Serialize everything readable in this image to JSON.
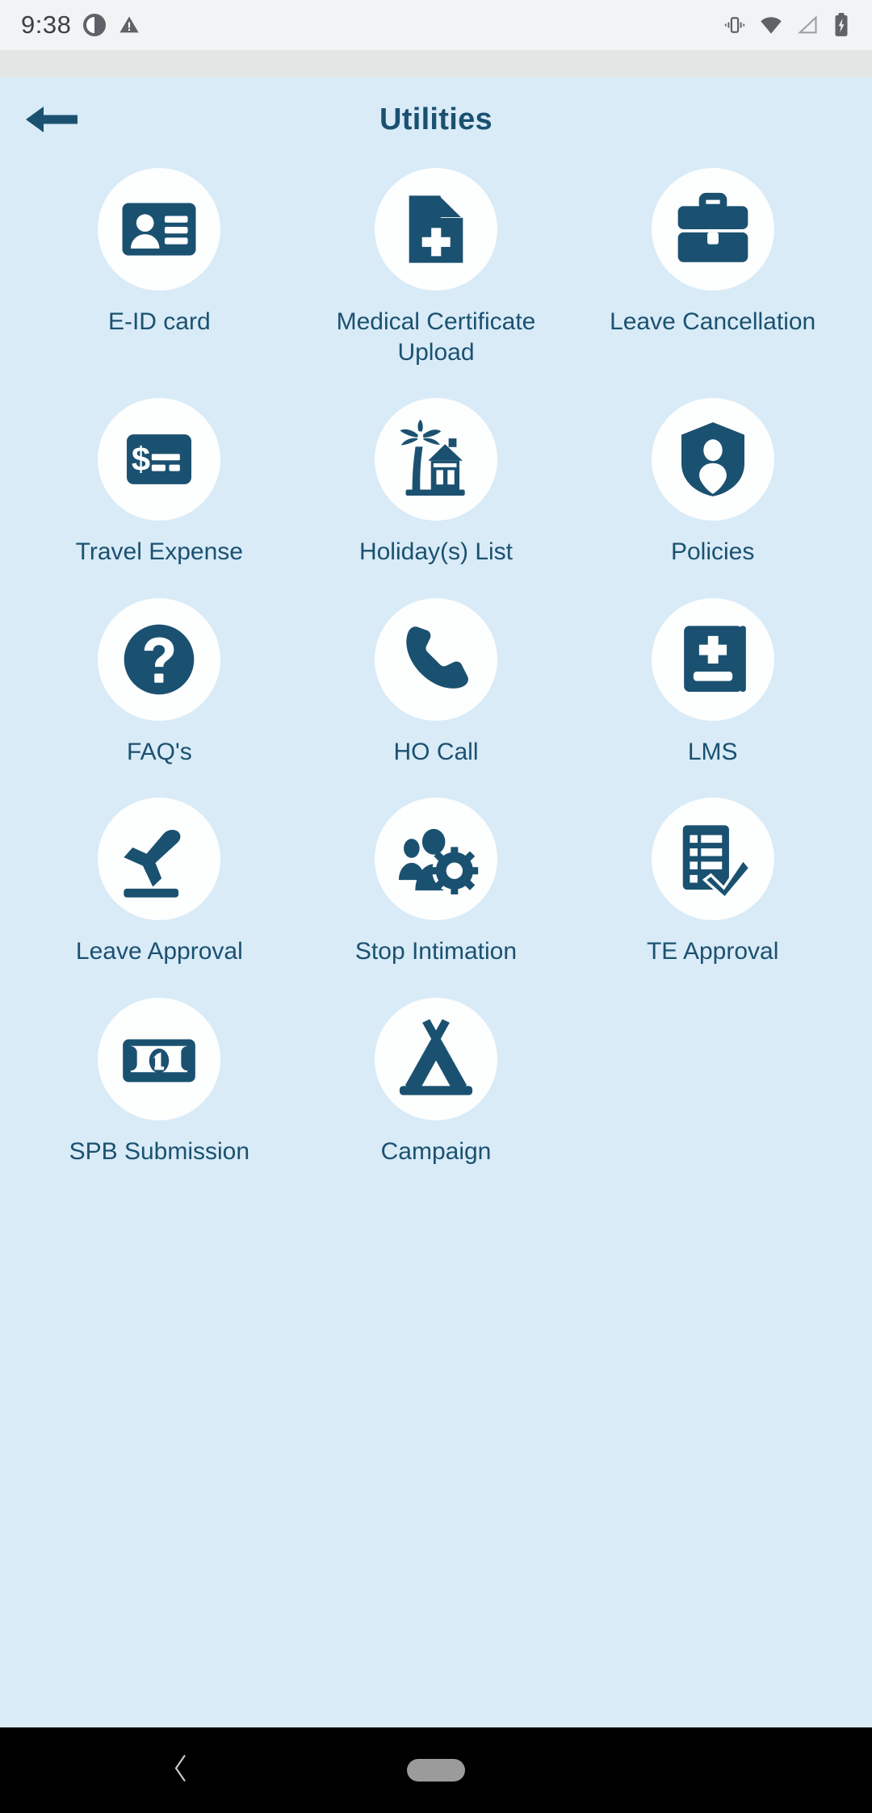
{
  "status_bar": {
    "time": "9:38",
    "left_icons": [
      "do-not-disturb-icon",
      "warning-icon"
    ],
    "right_icons": [
      "vibrate-icon",
      "wifi-icon",
      "cellular-signal-icon",
      "battery-charging-icon"
    ]
  },
  "header": {
    "title": "Utilities",
    "back_icon": "arrow-left-icon"
  },
  "theme": {
    "background": "#d8ebf7",
    "accent": "#1b5170",
    "circle": "#fdfefe",
    "status_bar_bg": "#f1f3f4",
    "sub_bar_bg": "#e2e6e4",
    "nav_bar_bg": "#000000"
  },
  "tiles": [
    {
      "label": "E-ID card",
      "icon": "id-card-icon"
    },
    {
      "label": "Medical Certificate Upload",
      "icon": "medical-document-icon"
    },
    {
      "label": "Leave Cancellation",
      "icon": "briefcase-icon"
    },
    {
      "label": "Travel Expense",
      "icon": "money-card-icon"
    },
    {
      "label": "Holiday(s) List",
      "icon": "palm-house-icon"
    },
    {
      "label": "Policies",
      "icon": "shield-person-icon"
    },
    {
      "label": "FAQ's",
      "icon": "question-circle-icon"
    },
    {
      "label": "HO Call",
      "icon": "phone-icon"
    },
    {
      "label": "LMS",
      "icon": "medical-book-icon"
    },
    {
      "label": "Leave Approval",
      "icon": "airplane-departure-icon"
    },
    {
      "label": "Stop Intimation",
      "icon": "people-gear-icon"
    },
    {
      "label": "TE Approval",
      "icon": "checklist-check-icon"
    },
    {
      "label": "SPB Submission",
      "icon": "banknote-icon"
    },
    {
      "label": "Campaign",
      "icon": "tent-icon"
    }
  ],
  "nav_bar": {
    "back_icon": "chevron-left-icon",
    "home_pill": "home-pill-handle"
  }
}
